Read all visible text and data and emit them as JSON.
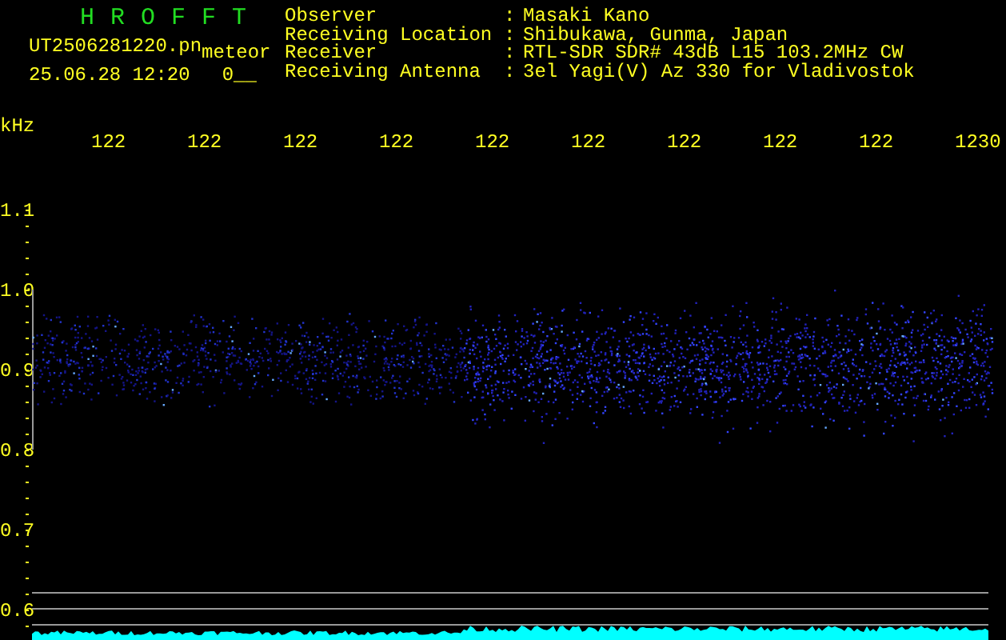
{
  "header": {
    "title": "H R O F F T",
    "filename": "UT2506281220.pn",
    "mode": "meteor",
    "timestamp": "25.06.28 12:20",
    "count": "0__"
  },
  "info": [
    {
      "label": "Observer",
      "separator": ":",
      "value": "Masaki Kano"
    },
    {
      "label": "Receiving Location",
      "separator": ":",
      "value": "Shibukawa, Gunma, Japan"
    },
    {
      "label": "Receiver",
      "separator": ":",
      "value": "RTL-SDR SDR# 43dB L15 103.2MHz CW"
    },
    {
      "label": "Receiving Antenna",
      "separator": ":",
      "value": "3el Yagi(V) Az 330 for Vladivostok"
    }
  ],
  "axis": {
    "unit": "kHz",
    "x_labels": [
      "122",
      "122",
      "122",
      "122",
      "122",
      "122",
      "122",
      "122",
      "122",
      "1230"
    ],
    "y_labels": [
      "1.1",
      "1.0",
      "0.9",
      "0.8",
      "0.7",
      "0.6"
    ]
  }
}
